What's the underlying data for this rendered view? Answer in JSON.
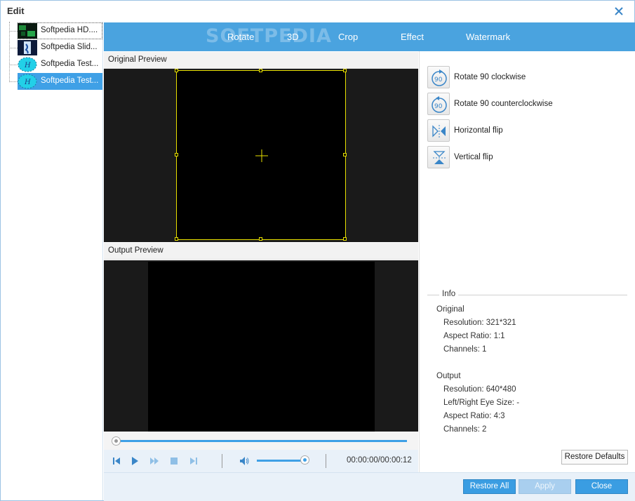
{
  "window": {
    "title": "Edit"
  },
  "files": [
    {
      "name": "Softpedia HD....",
      "thumb": "video-thumb-green"
    },
    {
      "name": "Softpedia Slid...",
      "thumb": "video-thumb-blue"
    },
    {
      "name": "Softpedia Test...",
      "thumb": "video-thumb-cyan"
    },
    {
      "name": "Softpedia Test...",
      "thumb": "video-thumb-cyan"
    }
  ],
  "tabs": [
    {
      "label": "Rotate"
    },
    {
      "label": "3D"
    },
    {
      "label": "Crop"
    },
    {
      "label": "Effect"
    },
    {
      "label": "Watermark"
    }
  ],
  "watermark_logo": "SOFTPEDIA",
  "preview": {
    "original_label": "Original Preview",
    "output_label": "Output Preview",
    "timecode": "00:00:00/00:00:12",
    "volume_level": 0.8,
    "seek_position": 0.0
  },
  "rotate_actions": [
    {
      "label": "Rotate 90 clockwise",
      "icon": "rotate-cw-icon"
    },
    {
      "label": "Rotate 90 counterclockwise",
      "icon": "rotate-ccw-icon"
    },
    {
      "label": "Horizontal flip",
      "icon": "flip-horizontal-icon"
    },
    {
      "label": "Vertical flip",
      "icon": "flip-vertical-icon"
    }
  ],
  "rotate_icon_text": "90",
  "info": {
    "title": "Info",
    "original_heading": "Original",
    "original_resolution": "Resolution: 321*321",
    "original_aspect": "Aspect Ratio: 1:1",
    "original_channels": "Channels: 1",
    "output_heading": "Output",
    "output_resolution": "Resolution: 640*480",
    "output_eye": "Left/Right Eye Size: -",
    "output_aspect": "Aspect Ratio: 4:3",
    "output_channels": "Channels: 2"
  },
  "buttons": {
    "restore_defaults": "Restore Defaults",
    "restore_all": "Restore All",
    "apply": "Apply",
    "close": "Close"
  },
  "colors": {
    "accent": "#3fa0e6",
    "tabbar": "#4aa3df",
    "crop_frame": "#e8e000"
  }
}
